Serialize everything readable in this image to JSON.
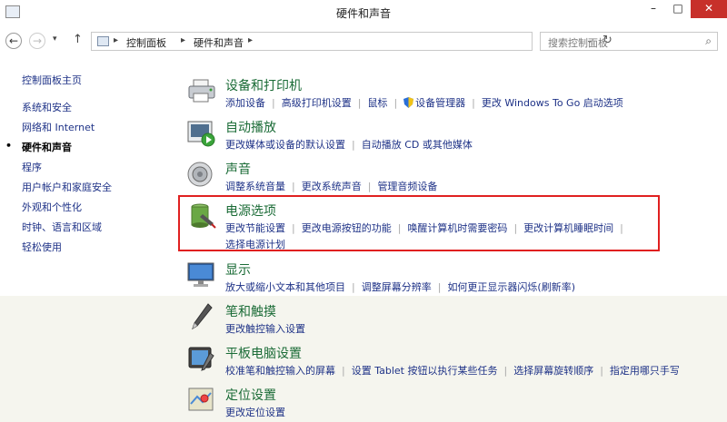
{
  "window": {
    "title": "硬件和声音",
    "minimize": "–",
    "maximize": "□",
    "close": "✕"
  },
  "address_bar": {
    "back": "←",
    "forward": "→",
    "recent": "▾",
    "up": "↑",
    "crumbs": [
      "控制面板",
      "硬件和声音"
    ],
    "crumb_sep": "▸",
    "dropdown": "⌄",
    "refresh": "↻",
    "search_placeholder": "搜索控制面板",
    "search_icon": "⌕"
  },
  "sidebar": {
    "items": [
      {
        "label": "控制面板主页"
      },
      {
        "label": "系统和安全"
      },
      {
        "label": "网络和 Internet"
      },
      {
        "label": "硬件和声音",
        "current": true
      },
      {
        "label": "程序"
      },
      {
        "label": "用户帐户和家庭安全"
      },
      {
        "label": "外观和个性化"
      },
      {
        "label": "时钟、语言和区域"
      },
      {
        "label": "轻松使用"
      }
    ],
    "bullet": "•"
  },
  "categories": [
    {
      "icon": "printer-icon",
      "title": "设备和打印机",
      "links": [
        "添加设备",
        "高级打印机设置",
        "鼠标",
        "设备管理器",
        "更改 Windows To Go 启动选项"
      ]
    },
    {
      "icon": "autoplay-icon",
      "title": "自动播放",
      "links": [
        "更改媒体或设备的默认设置",
        "自动播放 CD 或其他媒体"
      ]
    },
    {
      "icon": "speaker-icon",
      "title": "声音",
      "links": [
        "调整系统音量",
        "更改系统声音",
        "管理音频设备"
      ]
    },
    {
      "icon": "battery-icon",
      "title": "电源选项",
      "links": [
        "更改节能设置",
        "更改电源按钮的功能",
        "唤醒计算机时需要密码",
        "更改计算机睡眠时间"
      ],
      "links2": [
        "选择电源计划"
      ]
    },
    {
      "icon": "monitor-icon",
      "title": "显示",
      "links": [
        "放大或缩小文本和其他项目",
        "调整屏幕分辨率",
        "如何更正显示器闪烁(刷新率)"
      ]
    },
    {
      "icon": "pen-icon",
      "title": "笔和触摸",
      "links": [
        "更改触控输入设置"
      ]
    },
    {
      "icon": "tablet-icon",
      "title": "平板电脑设置",
      "links": [
        "校准笔和触控输入的屏幕",
        "设置 Tablet 按钮以执行某些任务",
        "选择屏幕旋转顺序",
        "指定用哪只手写"
      ]
    },
    {
      "icon": "location-icon",
      "title": "定位设置",
      "links": [
        "更改定位设置"
      ]
    }
  ],
  "colors": {
    "link": "#1e3287",
    "title": "#1a6b36",
    "highlight": "#e02020"
  }
}
